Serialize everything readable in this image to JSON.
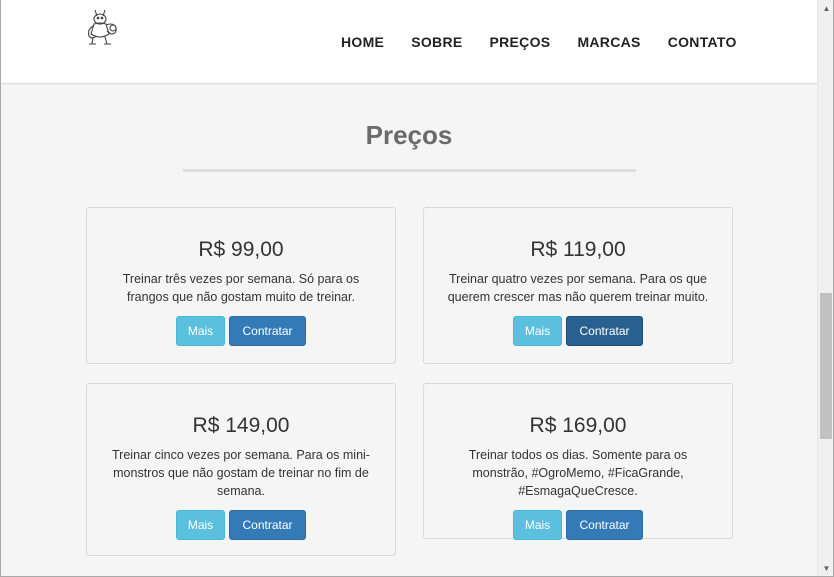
{
  "nav": {
    "logo_icon": "flexing-ogre-logo",
    "items": [
      {
        "label": "HOME"
      },
      {
        "label": "SOBRE"
      },
      {
        "label": "PREÇOS"
      },
      {
        "label": "MARCAS"
      },
      {
        "label": "CONTATO"
      }
    ]
  },
  "section": {
    "title": "Preços"
  },
  "plans": [
    {
      "price": "R$ 99,00",
      "description": "Treinar três vezes por semana. Só para os frangos que não gostam muito de treinar.",
      "more_label": "Mais",
      "hire_label": "Contratar"
    },
    {
      "price": "R$ 119,00",
      "description": "Treinar quatro vezes por semana. Para os que querem crescer mas não querem treinar muito.",
      "more_label": "Mais",
      "hire_label": "Contratar"
    },
    {
      "price": "R$ 149,00",
      "description": "Treinar cinco vezes por semana. Para os mini-monstros que não gostam de treinar no fim de semana.",
      "more_label": "Mais",
      "hire_label": "Contratar"
    },
    {
      "price": "R$ 169,00",
      "description": "Treinar todos os dias. Somente para os monstrão, #OgroMemo, #FicaGrande, #EsmagaQueCresce.",
      "more_label": "Mais",
      "hire_label": "Contratar"
    }
  ],
  "colors": {
    "more_button": "#5bc0de",
    "hire_button": "#337ab7",
    "hire_button_active": "#286090",
    "title": "#6b6b6b"
  }
}
